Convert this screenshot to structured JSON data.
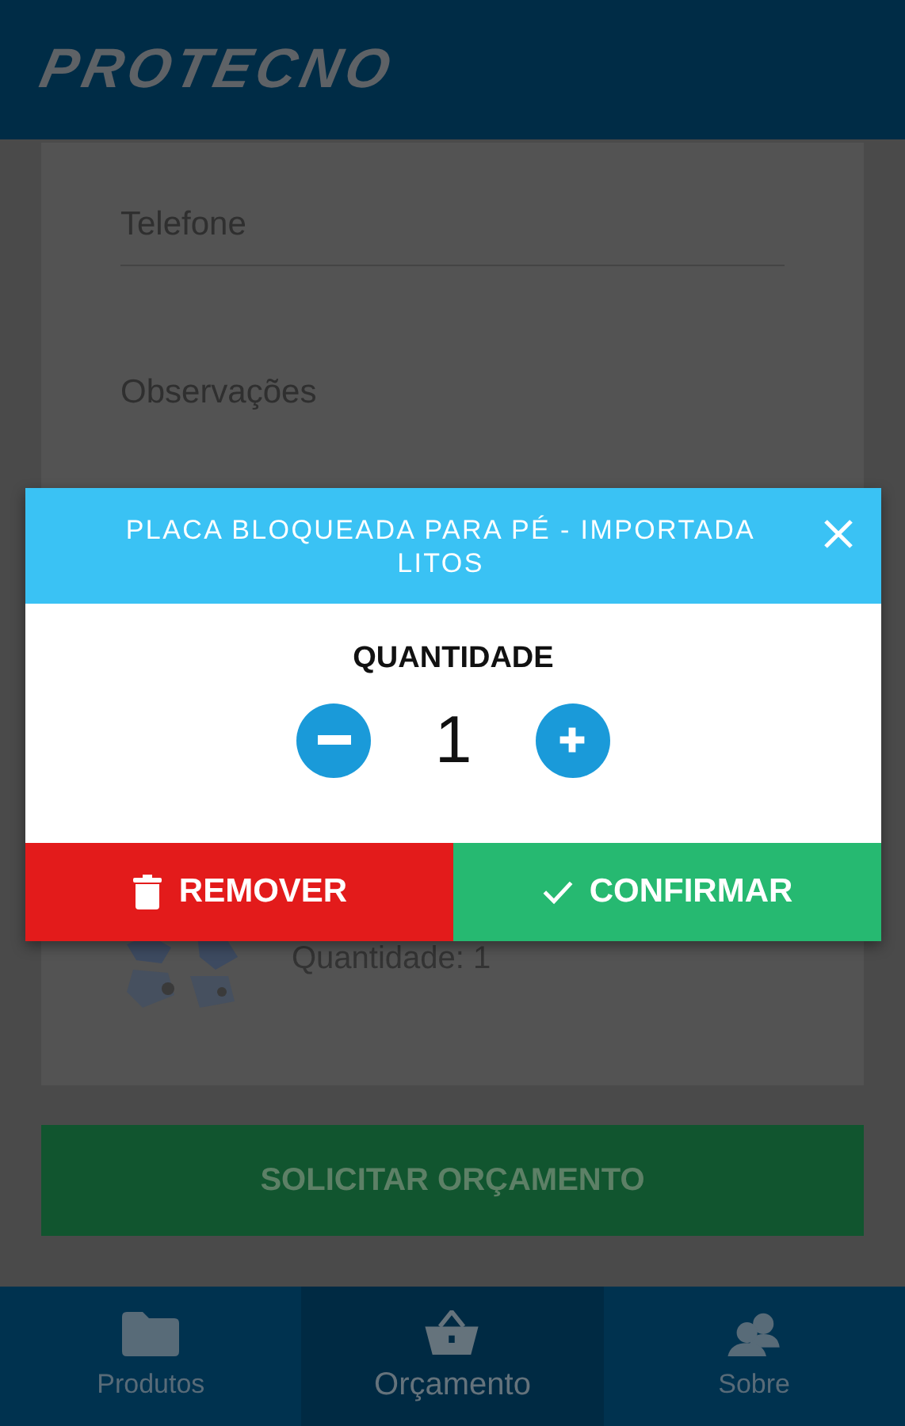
{
  "header": {
    "logo": "PROTECNO"
  },
  "form": {
    "fields": [
      {
        "kind": "line",
        "placeholder": "Telefone"
      },
      {
        "kind": "area",
        "placeholder": "Observações"
      }
    ]
  },
  "cart_items": [
    {
      "quantity": "Quantidade: 1"
    }
  ],
  "submit_button": {
    "label": "SOLICITAR ORÇAMENTO"
  },
  "nav": [
    {
      "kind": "folder",
      "label": "Produtos",
      "selected": false
    },
    {
      "kind": "basket",
      "label": "Orçamento",
      "selected": true
    },
    {
      "kind": "people",
      "label": "Sobre",
      "selected": false
    }
  ],
  "dialog": {
    "title": "PLACA BLOQUEADA PARA PÉ - IMPORTADA LITOS",
    "label": "QUANTIDADE",
    "value": "1",
    "buttons": [
      {
        "kind": "remove",
        "label": "REMOVER"
      },
      {
        "kind": "confirm",
        "label": "CONFIRMAR"
      }
    ]
  }
}
